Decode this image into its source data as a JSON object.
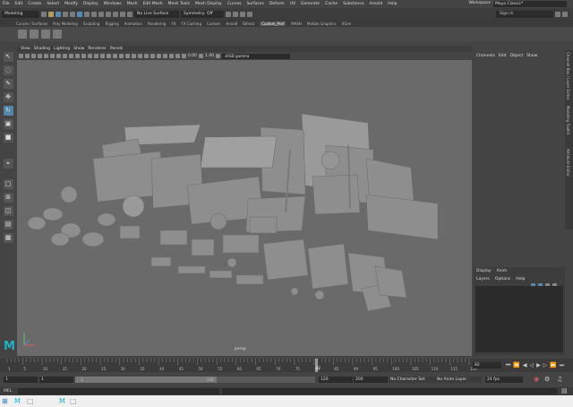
{
  "menu": [
    "File",
    "Edit",
    "Create",
    "Select",
    "Modify",
    "Display",
    "Windows",
    "Mesh",
    "Edit Mesh",
    "Mesh Tools",
    "Mesh Display",
    "Curves",
    "Surfaces",
    "Deform",
    "UV",
    "Generate",
    "Cache",
    "Substance",
    "Arnold",
    "Help"
  ],
  "workspace": {
    "label": "Workspace :",
    "value": "Maya Classic*"
  },
  "status": {
    "mode": "Modeling",
    "live": "No Live Surface",
    "symmetry": "Symmetry: Off",
    "signin": "Sign In"
  },
  "shelf_tabs": [
    "Curves / Surfaces",
    "Poly Modeling",
    "Sculpting",
    "Rigging",
    "Animation",
    "Rendering",
    "FX",
    "FX Caching",
    "Custom",
    "Arnold",
    "Bifrost",
    "Custom_Prof",
    "MASH",
    "Motion Graphics",
    "XGen"
  ],
  "shelf_active": "Custom_Prof",
  "panel_menu": [
    "View",
    "Shading",
    "Lighting",
    "Show",
    "Renderer",
    "Panels"
  ],
  "panel_values": {
    "a": "0.00",
    "b": "1.00",
    "colorspace": "sRGB gamma"
  },
  "camera": "persp",
  "channel_box": {
    "menu": [
      "Channels",
      "Edit",
      "Object",
      "Show"
    ]
  },
  "side_tabs": [
    "Channel Box / Layer Editor",
    "Modeling Toolkit",
    "Attribute Editor"
  ],
  "layer_editor": {
    "tabs": [
      "Display",
      "Anim"
    ],
    "menu": [
      "Layers",
      "Options",
      "Help"
    ]
  },
  "timeline": {
    "ticks": [
      "1",
      "5",
      "10",
      "15",
      "20",
      "25",
      "30",
      "35",
      "40",
      "45",
      "50",
      "55",
      "60",
      "65",
      "70",
      "75",
      "80",
      "85",
      "90",
      "95",
      "100",
      "105",
      "110",
      "115",
      "120"
    ],
    "current": "82",
    "current_field": "82"
  },
  "range": {
    "start": "1",
    "start2": "1",
    "slider_left": "1",
    "slider_right": "120",
    "end": "120",
    "end2": "200",
    "character": "No Character Set",
    "anim_layer": "No Anim Layer",
    "fps": "24 fps"
  },
  "mel_label": "MEL",
  "colors": {
    "accent": "#5285a6",
    "viewport": "#6a6a6a",
    "maya": "#1fb4c5"
  }
}
